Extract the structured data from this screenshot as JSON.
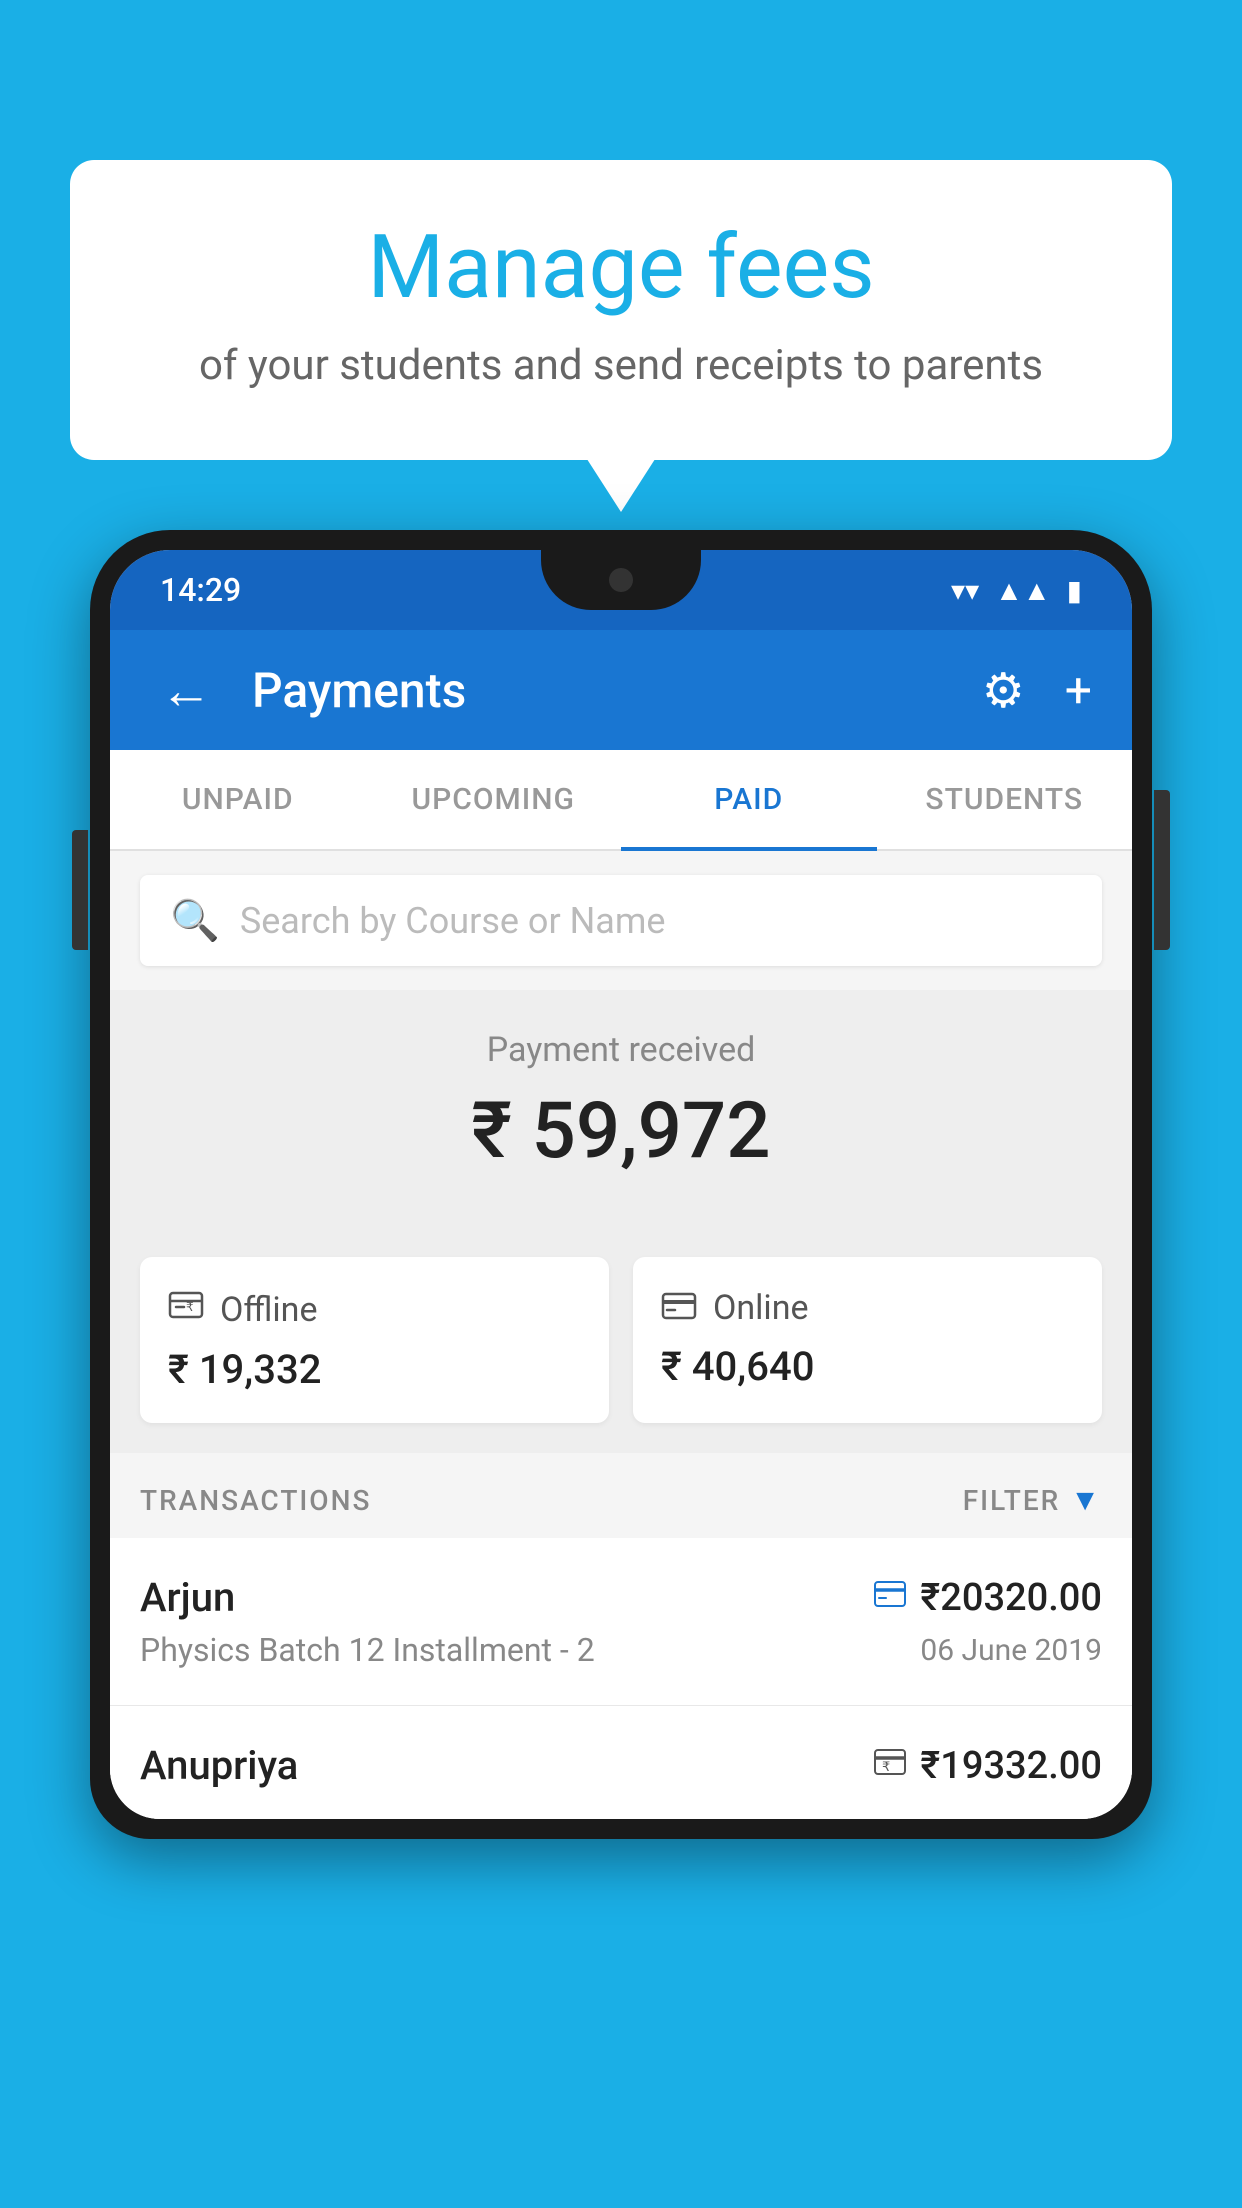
{
  "background_color": "#1AAFE6",
  "bubble": {
    "title": "Manage fees",
    "subtitle": "of your students and send receipts to parents"
  },
  "status_bar": {
    "time": "14:29",
    "wifi": "▾",
    "signal": "▴",
    "battery": "▮"
  },
  "app_bar": {
    "title": "Payments",
    "back_label": "←",
    "gear_label": "⚙",
    "plus_label": "+"
  },
  "tabs": [
    {
      "label": "UNPAID",
      "active": false
    },
    {
      "label": "UPCOMING",
      "active": false
    },
    {
      "label": "PAID",
      "active": true
    },
    {
      "label": "STUDENTS",
      "active": false
    }
  ],
  "search": {
    "placeholder": "Search by Course or Name"
  },
  "payment_summary": {
    "label": "Payment received",
    "amount": "₹ 59,972"
  },
  "payment_cards": [
    {
      "icon": "₹",
      "label": "Offline",
      "amount": "₹ 19,332"
    },
    {
      "icon": "💳",
      "label": "Online",
      "amount": "₹ 40,640"
    }
  ],
  "transactions": {
    "header_label": "TRANSACTIONS",
    "filter_label": "FILTER"
  },
  "transaction_list": [
    {
      "name": "Arjun",
      "course": "Physics Batch 12 Installment - 2",
      "amount": "₹20320.00",
      "date": "06 June 2019",
      "payment_type": "online"
    },
    {
      "name": "Anupriya",
      "course": "",
      "amount": "₹19332.00",
      "date": "",
      "payment_type": "offline"
    }
  ]
}
